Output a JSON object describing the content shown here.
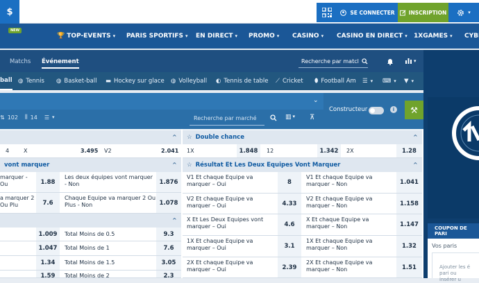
{
  "topbar": {
    "currency_symbol": "$",
    "login_label": "SE CONNECTER",
    "signup_label": "INSCRIPTION"
  },
  "nav": {
    "new_badge": "NEW",
    "items": [
      "TOP-EVENTS",
      "PARIS SPORTIFS",
      "EN DIRECT",
      "PROMO",
      "CASINO",
      "CASINO EN DIRECT",
      "1XGAMES",
      "CYBE"
    ]
  },
  "subnav": {
    "tabs": [
      "Matchs",
      "Événement"
    ],
    "search_placeholder": "Recherche par matcl"
  },
  "sports": [
    "ball",
    "Tennis",
    "Basket-ball",
    "Hockey sur glace",
    "Volleyball",
    "Tennis de table",
    "Cricket",
    "Football Am"
  ],
  "filter": {
    "count_a": "102",
    "count_b": "14",
    "market_search_placeholder": "Recherche par marché",
    "constructor_label": "Constructeur"
  },
  "left_markets": {
    "row1": {
      "c1": "4",
      "c2": "X",
      "c3": "3.495",
      "c4": "V2",
      "c5": "2.041"
    },
    "section2_title": "vont marquer",
    "row2": {
      "l1": "marquer - Ou",
      "v1": "1.88",
      "l2": "Les deux équipes vont marquer - Non",
      "v2": "1.876"
    },
    "row3": {
      "l1": "a marquer 2 Ou Plu",
      "v1": "7.6",
      "l2": "Chaque Equipe va marquer 2 Ou Plus - Non",
      "v2": "1.078"
    },
    "totals": [
      {
        "v1": "1.009",
        "label": "Total Moins de 0.5",
        "v2": "9.3"
      },
      {
        "v1": "1.047",
        "label": "Total Moins de 1",
        "v2": "7.6"
      },
      {
        "v1": "1.34",
        "label": "Total Moins de 1.5",
        "v2": "3.05"
      },
      {
        "v1": "1.59",
        "label": "Total Moins de 2",
        "v2": "2.3"
      }
    ]
  },
  "right_markets": {
    "double_chance_title": "Double chance",
    "dc": [
      {
        "label": "1X",
        "value": "1.848"
      },
      {
        "label": "12",
        "value": "1.342"
      },
      {
        "label": "2X",
        "value": "1.28"
      }
    ],
    "btts_title": "Résultat Et Les Deux Equipes Vont Marquer",
    "rows": [
      {
        "l1": "V1 Et chaque Equipe va marquer – Oui",
        "v1": "8",
        "l2": "V1 Et chaque Equipe va marquer – Non",
        "v2": "1.041"
      },
      {
        "l1": "V2 Et chaque Equipe va marquer – Oui",
        "v1": "4.33",
        "l2": "V2 Et chaque Equipe va marquer – Non",
        "v2": "1.158"
      },
      {
        "l1": "X Et Les Deux Equipes vont marquer – Oui",
        "v1": "4.6",
        "l2": "X Et chaque Equipe va marquer – Non",
        "v2": "1.147"
      },
      {
        "l1": "1X Et chaque Equipe va marquer – Oui",
        "v1": "3.1",
        "l2": "1X Et chaque Equipe va marquer – Non",
        "v2": "1.32"
      },
      {
        "l1": "2X Et chaque Equipe va marquer – Oui",
        "v1": "2.39",
        "l2": "2X Et chaque Equipe va marquer – Non",
        "v2": "1.51"
      }
    ]
  },
  "coupon": {
    "title": "COUPON DE PARI",
    "vos_paris": "Vos paris",
    "hint": "Ajouter les é pari ou insérer u"
  },
  "colors": {
    "brand_blue": "#1b5797",
    "accent_green": "#70a32c",
    "odds_blue": "#0f5aa1"
  }
}
